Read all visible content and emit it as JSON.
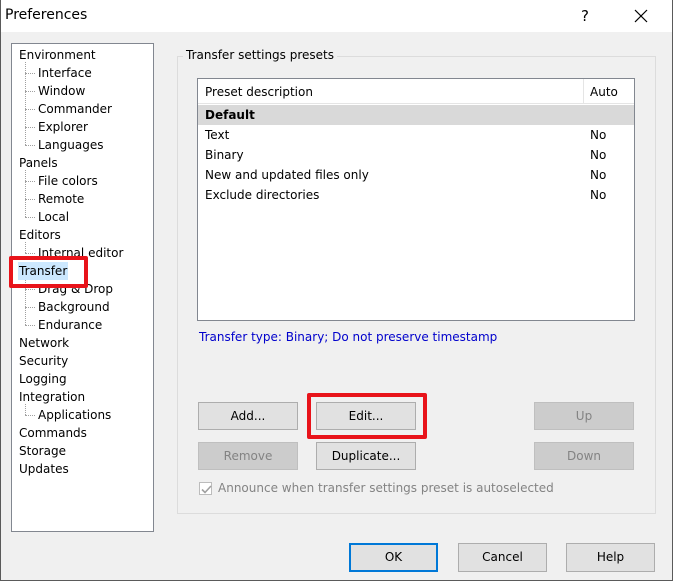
{
  "window": {
    "title": "Preferences",
    "help_glyph": "?"
  },
  "tree": {
    "items": [
      {
        "label": "Environment",
        "level": 0,
        "selected": false
      },
      {
        "label": "Interface",
        "level": 1,
        "selected": false
      },
      {
        "label": "Window",
        "level": 1,
        "selected": false
      },
      {
        "label": "Commander",
        "level": 1,
        "selected": false
      },
      {
        "label": "Explorer",
        "level": 1,
        "selected": false
      },
      {
        "label": "Languages",
        "level": 1,
        "selected": false
      },
      {
        "label": "Panels",
        "level": 0,
        "selected": false
      },
      {
        "label": "File colors",
        "level": 1,
        "selected": false
      },
      {
        "label": "Remote",
        "level": 1,
        "selected": false
      },
      {
        "label": "Local",
        "level": 1,
        "selected": false
      },
      {
        "label": "Editors",
        "level": 0,
        "selected": false
      },
      {
        "label": "Internal editor",
        "level": 1,
        "selected": false
      },
      {
        "label": "Transfer",
        "level": 0,
        "selected": true
      },
      {
        "label": "Drag & Drop",
        "level": 1,
        "selected": false
      },
      {
        "label": "Background",
        "level": 1,
        "selected": false
      },
      {
        "label": "Endurance",
        "level": 1,
        "selected": false
      },
      {
        "label": "Network",
        "level": 0,
        "selected": false
      },
      {
        "label": "Security",
        "level": 0,
        "selected": false
      },
      {
        "label": "Logging",
        "level": 0,
        "selected": false
      },
      {
        "label": "Integration",
        "level": 0,
        "selected": false
      },
      {
        "label": "Applications",
        "level": 1,
        "selected": false
      },
      {
        "label": "Commands",
        "level": 0,
        "selected": false
      },
      {
        "label": "Storage",
        "level": 0,
        "selected": false
      },
      {
        "label": "Updates",
        "level": 0,
        "selected": false
      }
    ]
  },
  "presets": {
    "group_label": "Transfer settings presets",
    "columns": [
      "Preset description",
      "Auto"
    ],
    "rows": [
      {
        "description": "Default",
        "auto": "",
        "selected": true
      },
      {
        "description": "Text",
        "auto": "No",
        "selected": false
      },
      {
        "description": "Binary",
        "auto": "No",
        "selected": false
      },
      {
        "description": "New and updated files only",
        "auto": "No",
        "selected": false
      },
      {
        "description": "Exclude directories",
        "auto": "No",
        "selected": false
      }
    ],
    "transfer_type": "Transfer type: Binary; Do not preserve timestamp"
  },
  "buttons": {
    "add": "Add...",
    "edit": "Edit...",
    "up": "Up",
    "remove": "Remove",
    "duplicate": "Duplicate...",
    "down": "Down",
    "ok": "OK",
    "cancel": "Cancel",
    "help": "Help"
  },
  "announce": {
    "label": "Announce when transfer settings preset is autoselected",
    "checked": true
  },
  "colors": {
    "highlight": "#e8131a",
    "link_blue": "#0000cc",
    "default_button_border": "#0078d7"
  }
}
